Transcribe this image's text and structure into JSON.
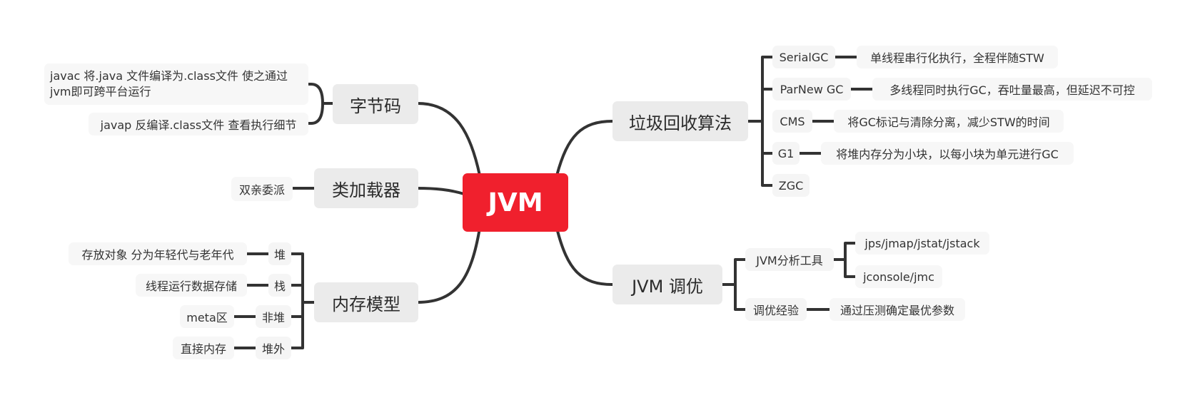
{
  "root": {
    "label": "JVM"
  },
  "left": {
    "bytecode": {
      "label": "字节码",
      "children": [
        "javac 将.java 文件编译为.class文件 使之通过jvm即可跨平台运行",
        "javap 反编译.class文件 查看执行细节"
      ]
    },
    "classloader": {
      "label": "类加载器",
      "children": [
        "双亲委派"
      ]
    },
    "memory": {
      "label": "内存模型",
      "children": [
        {
          "label": "堆",
          "detail": "存放对象 分为年轻代与老年代"
        },
        {
          "label": "栈",
          "detail": "线程运行数据存储"
        },
        {
          "label": "非堆",
          "detail": "meta区"
        },
        {
          "label": "堆外",
          "detail": "直接内存"
        }
      ]
    }
  },
  "right": {
    "gc": {
      "label": "垃圾回收算法",
      "children": [
        {
          "label": "SerialGC",
          "detail": "单线程串行化执行，全程伴随STW"
        },
        {
          "label": "ParNew GC",
          "detail": "多线程同时执行GC，吞吐量最高，但延迟不可控"
        },
        {
          "label": "CMS",
          "detail": "将GC标记与清除分离，减少STW的时间"
        },
        {
          "label": "G1",
          "detail": "将堆内存分为小块，以每小块为单元进行GC"
        },
        {
          "label": "ZGC"
        }
      ]
    },
    "tuning": {
      "label": "JVM 调优",
      "tools": {
        "label": "JVM分析工具",
        "children": [
          "jps/jmap/jstat/jstack",
          "jconsole/jmc"
        ]
      },
      "experience": {
        "label": "调优经验",
        "detail": "通过压测确定最优参数"
      }
    }
  },
  "colors": {
    "root": "#f0202d",
    "line": "#333333",
    "main_bg": "#ebebeb",
    "sub_bg": "#f5f5f5"
  }
}
